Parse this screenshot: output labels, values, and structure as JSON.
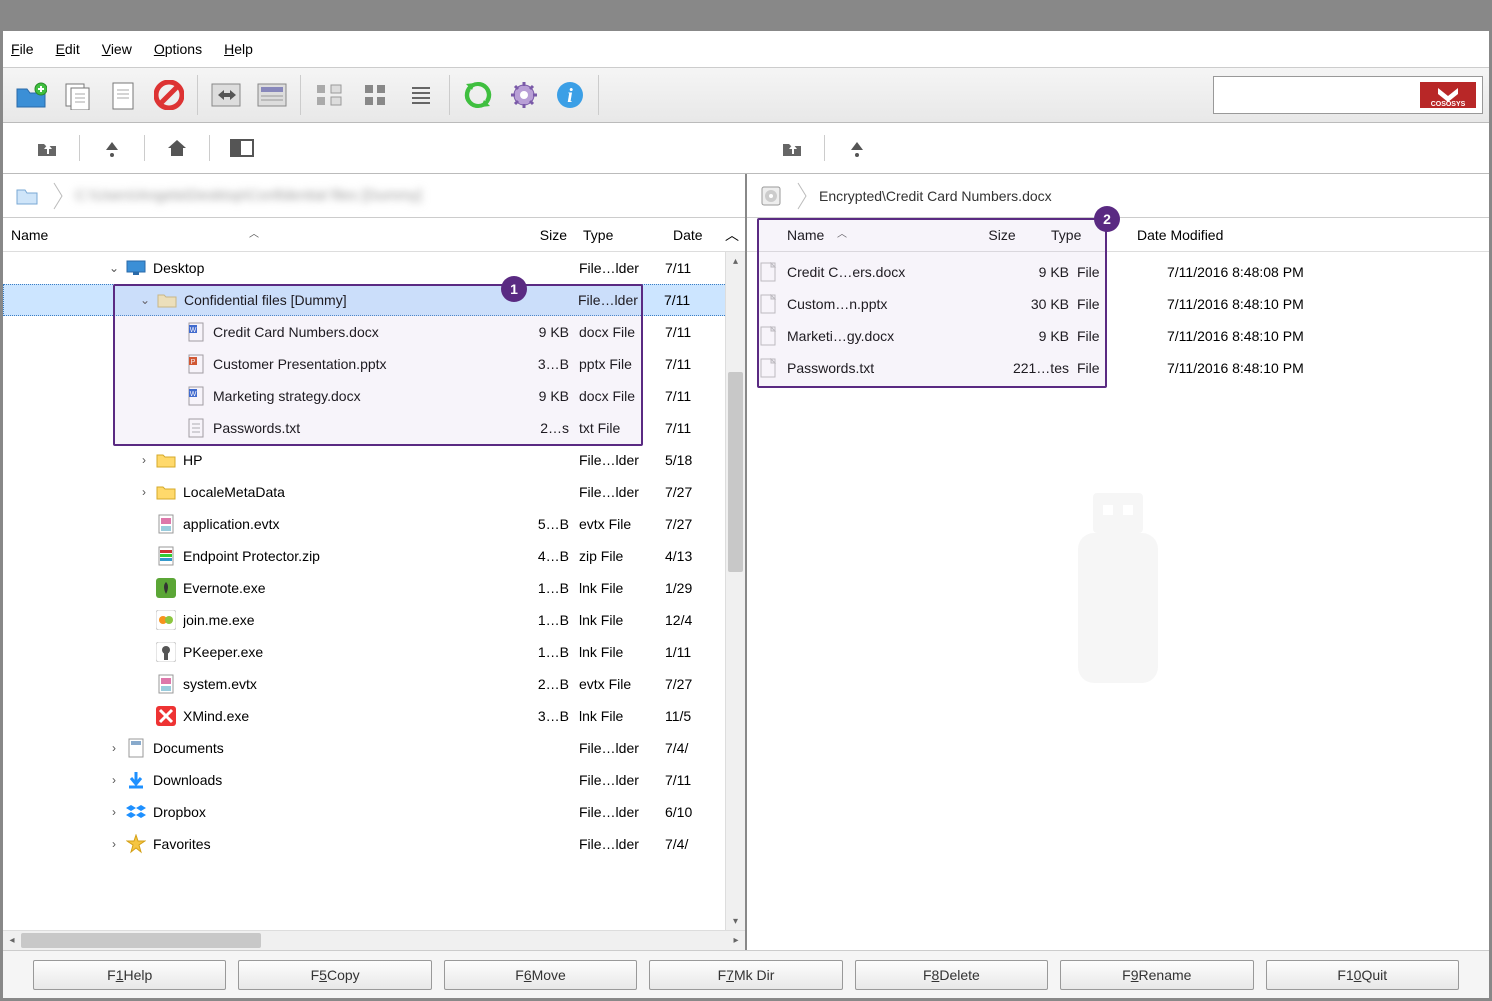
{
  "menubar": {
    "file": "File",
    "edit": "Edit",
    "view": "View",
    "options": "Options",
    "help": "Help"
  },
  "toolbar": {
    "logo_text": "COSOSYS"
  },
  "left": {
    "breadcrumb_blurred": "C:\\Users\\Angela\\Desktop\\Confidential files [Dummy]",
    "columns": {
      "name": "Name",
      "size": "Size",
      "type": "Type",
      "date": "Date"
    },
    "rows": [
      {
        "indent": 1,
        "expander": "v",
        "icon": "monitor",
        "name": "Desktop",
        "size": "",
        "type": "File…lder",
        "date": "7/11"
      },
      {
        "indent": 2,
        "expander": "v",
        "icon": "folder",
        "name": "Confidential files [Dummy]",
        "size": "",
        "type": "File…lder",
        "date": "7/11",
        "selected": true
      },
      {
        "indent": 3,
        "expander": "",
        "icon": "docx",
        "name": "Credit Card Numbers.docx",
        "size": "9 KB",
        "type": "docx File",
        "date": "7/11"
      },
      {
        "indent": 3,
        "expander": "",
        "icon": "pptx",
        "name": "Customer Presentation.pptx",
        "size": "3…B",
        "type": "pptx File",
        "date": "7/11"
      },
      {
        "indent": 3,
        "expander": "",
        "icon": "docx",
        "name": "Marketing strategy.docx",
        "size": "9 KB",
        "type": "docx File",
        "date": "7/11"
      },
      {
        "indent": 3,
        "expander": "",
        "icon": "txt",
        "name": "Passwords.txt",
        "size": "2…s",
        "type": "txt File",
        "date": "7/11"
      },
      {
        "indent": 2,
        "expander": ">",
        "icon": "folder-y",
        "name": "HP",
        "size": "",
        "type": "File…lder",
        "date": "5/18"
      },
      {
        "indent": 2,
        "expander": ">",
        "icon": "folder-y",
        "name": "LocaleMetaData",
        "size": "",
        "type": "File…lder",
        "date": "7/27"
      },
      {
        "indent": 2,
        "expander": "",
        "icon": "evtx",
        "name": "application.evtx",
        "size": "5…B",
        "type": "evtx File",
        "date": "7/27"
      },
      {
        "indent": 2,
        "expander": "",
        "icon": "zip",
        "name": "Endpoint Protector.zip",
        "size": "4…B",
        "type": "zip File",
        "date": "4/13"
      },
      {
        "indent": 2,
        "expander": "",
        "icon": "evernote",
        "name": "Evernote.exe",
        "size": "1…B",
        "type": "lnk File",
        "date": "1/29"
      },
      {
        "indent": 2,
        "expander": "",
        "icon": "joinme",
        "name": "join.me.exe",
        "size": "1…B",
        "type": "lnk File",
        "date": "12/4"
      },
      {
        "indent": 2,
        "expander": "",
        "icon": "pkeeper",
        "name": "PKeeper.exe",
        "size": "1…B",
        "type": "lnk File",
        "date": "1/11"
      },
      {
        "indent": 2,
        "expander": "",
        "icon": "evtx",
        "name": "system.evtx",
        "size": "2…B",
        "type": "evtx File",
        "date": "7/27"
      },
      {
        "indent": 2,
        "expander": "",
        "icon": "xmind",
        "name": "XMind.exe",
        "size": "3…B",
        "type": "lnk File",
        "date": "11/5"
      },
      {
        "indent": 1,
        "expander": ">",
        "icon": "doc-lib",
        "name": "Documents",
        "size": "",
        "type": "File…lder",
        "date": "7/4/"
      },
      {
        "indent": 1,
        "expander": ">",
        "icon": "download",
        "name": "Downloads",
        "size": "",
        "type": "File…lder",
        "date": "7/11"
      },
      {
        "indent": 1,
        "expander": ">",
        "icon": "dropbox",
        "name": "Dropbox",
        "size": "",
        "type": "File…lder",
        "date": "6/10"
      },
      {
        "indent": 1,
        "expander": ">",
        "icon": "star",
        "name": "Favorites",
        "size": "",
        "type": "File…lder",
        "date": "7/4/"
      }
    ]
  },
  "right": {
    "breadcrumb": "Encrypted\\Credit Card Numbers.docx",
    "columns": {
      "name": "Name",
      "size": "Size",
      "type": "Type",
      "date": "Date Modified"
    },
    "rows": [
      {
        "icon": "file",
        "name": "Credit C…ers.docx",
        "size": "9 KB",
        "type": "File",
        "date": "7/11/2016 8:48:08 PM"
      },
      {
        "icon": "file",
        "name": "Custom…n.pptx",
        "size": "30 KB",
        "type": "File",
        "date": "7/11/2016 8:48:10 PM"
      },
      {
        "icon": "file",
        "name": "Marketi…gy.docx",
        "size": "9 KB",
        "type": "File",
        "date": "7/11/2016 8:48:10 PM"
      },
      {
        "icon": "file",
        "name": "Passwords.txt",
        "size": "221…tes",
        "type": "File",
        "date": "7/11/2016 8:48:10 PM"
      }
    ]
  },
  "annotations": {
    "badge1": "1",
    "badge2": "2"
  },
  "footer": {
    "help": "Help",
    "copy": "Copy",
    "move": "Move",
    "mkdir": "Mk Dir",
    "delete": "Delete",
    "rename": "Rename",
    "quit": "Quit"
  }
}
